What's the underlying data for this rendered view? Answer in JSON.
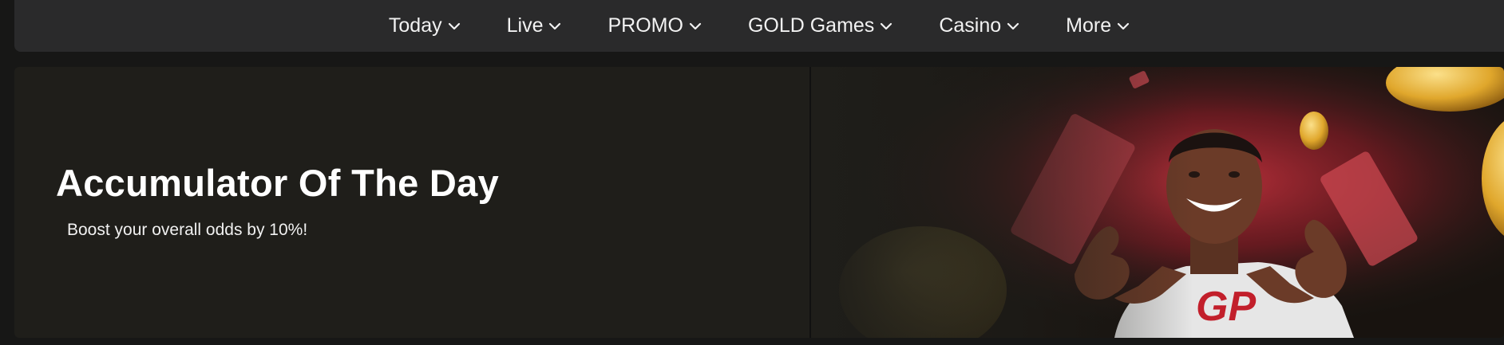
{
  "nav": {
    "items": [
      {
        "label": "Today"
      },
      {
        "label": "Live"
      },
      {
        "label": "PROMO"
      },
      {
        "label": "GOLD Games"
      },
      {
        "label": "Casino"
      },
      {
        "label": "More"
      }
    ]
  },
  "banner": {
    "title": "Accumulator Of The Day",
    "subtitle": "Boost your overall odds by 10%!",
    "logo_text": "GP",
    "colors": {
      "background": "#1f1e1a",
      "glow": "#c0313c",
      "coin": "#e0a72c",
      "shirt": "#e6e6e6",
      "logo": "#c21f2b"
    }
  },
  "colors": {
    "page_bg": "#171716",
    "navbar_bg": "#2a2a2b",
    "nav_text": "#f2f2f2"
  }
}
